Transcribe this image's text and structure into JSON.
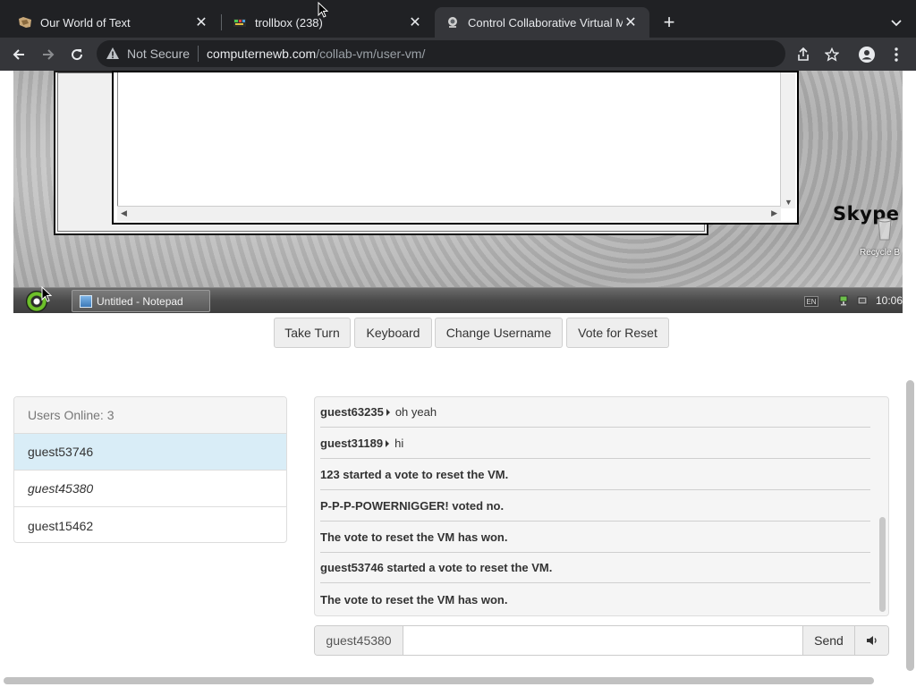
{
  "browser": {
    "tabs": [
      {
        "title": "Our World of Text",
        "active": false
      },
      {
        "title": "trollbox (238)",
        "active": false
      },
      {
        "title": "Control Collaborative Virtual M",
        "active": true
      }
    ],
    "address": {
      "security_label": "Not Secure",
      "host": "computernewb.com",
      "path": "/collab-vm/user-vm/"
    }
  },
  "vm": {
    "taskbar_item": "Untitled - Notepad",
    "tray_lang": "EN",
    "clock": "10:06",
    "desktop_icon_label": "Skype X",
    "recycle_label": "Recycle B"
  },
  "controls": {
    "take_turn": "Take Turn",
    "keyboard": "Keyboard",
    "change_username": "Change Username",
    "vote_reset": "Vote for Reset"
  },
  "users": {
    "header": "Users Online: 3",
    "list": [
      "guest53746",
      "guest45380",
      "guest15462"
    ]
  },
  "chat": {
    "messages": [
      {
        "user": "guest63235",
        "text": "oh yeah"
      },
      {
        "user": "guest31189",
        "text": "hi"
      },
      {
        "user": "",
        "text": "123 started a vote to reset the VM."
      },
      {
        "user": "",
        "text": "P-P-P-POWERNIGGER! voted no."
      },
      {
        "user": "",
        "text": "The vote to reset the VM has won."
      },
      {
        "user": "",
        "text": "guest53746 started a vote to reset the VM."
      },
      {
        "user": "",
        "text": "The vote to reset the VM has won."
      }
    ],
    "username": "guest45380",
    "input_value": "",
    "send_label": "Send"
  },
  "icons": {
    "tab1": "owot-favicon",
    "tab2": "trollbox-favicon",
    "tab3": "collabvm-favicon",
    "volume": "volume-icon"
  },
  "colors": {
    "chrome_dark": "#202124",
    "chrome_toolbar": "#35363a",
    "selected_user": "#d9edf7",
    "panel_bg": "#f5f5f5"
  }
}
